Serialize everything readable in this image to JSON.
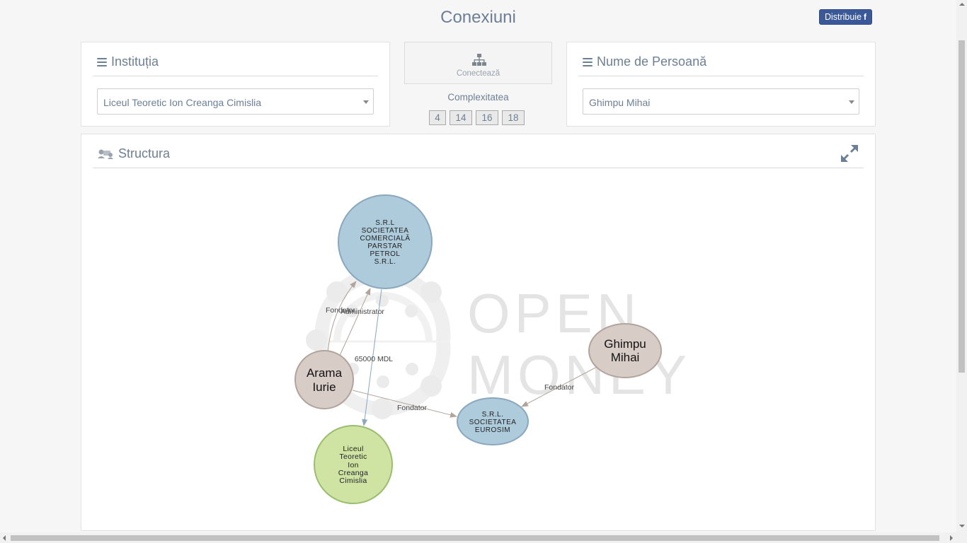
{
  "header": {
    "title": "Conexiuni",
    "share_label": "Distribuie",
    "share_icon": "facebook-icon"
  },
  "institution": {
    "title": "Instituția",
    "selected": "Liceul Teoretic Ion Creanga Cimislia"
  },
  "connect": {
    "label": "Conectează",
    "icon": "sitemap-icon"
  },
  "complexity": {
    "label": "Complexitatea",
    "options": [
      "4",
      "14",
      "16",
      "18"
    ]
  },
  "person": {
    "title": "Nume de Persoană",
    "selected": "Ghimpu Mihai"
  },
  "structure": {
    "title": "Structura",
    "expand_icon": "expand-icon"
  },
  "watermark": {
    "line1": "OPEN",
    "line2": "MONEY"
  },
  "graph": {
    "nodes": {
      "parstar": {
        "lines": [
          "S.R.L",
          "SOCIETATEA",
          "COMERCIALĂ",
          "PARSTAR",
          "PETROL",
          "S.R.L."
        ]
      },
      "arama": {
        "lines": [
          "Arama",
          "Iurie"
        ]
      },
      "ghimpu": {
        "lines": [
          "Ghimpu",
          "Mihai"
        ]
      },
      "eurosim": {
        "lines": [
          "S.R.L.",
          "SOCIETATEA",
          "EUROSIM"
        ]
      },
      "liceul": {
        "lines": [
          "Liceul",
          "Teoretic",
          "Ion",
          "Creanga",
          "Cimislia"
        ]
      }
    },
    "edges": {
      "fondator_parstar": "Fondator",
      "admin_parstar": "Administrator",
      "amount": "65000 MDL",
      "fondator_eurosim_arama": "Fondator",
      "fondator_eurosim_ghimpu": "Fondator"
    }
  },
  "colors": {
    "company": "#aecbdc",
    "person": "#d8ccc7",
    "institution": "#cfe4a3",
    "accent": "#3b5998"
  }
}
